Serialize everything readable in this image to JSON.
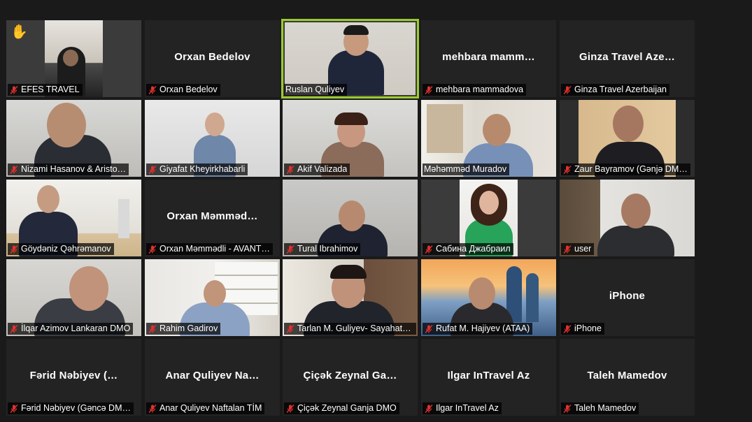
{
  "meeting": {
    "tiles": [
      {
        "label": "EFES TRAVEL",
        "big": "",
        "video": true,
        "hand": true,
        "muted": true
      },
      {
        "label": "Orxan Bedelov",
        "big": "Orxan Bedelov",
        "video": false,
        "muted": true
      },
      {
        "label": "Ruslan Quliyev",
        "big": "",
        "video": true,
        "active": true,
        "muted": false
      },
      {
        "label": "mehbara mammadova",
        "big": "mehbara  mamm…",
        "video": false,
        "muted": true
      },
      {
        "label": "Ginza Travel Azerbaijan",
        "big": "Ginza  Travel  Aze…",
        "video": false,
        "muted": true
      },
      {
        "label": "Nizami Hasanov  &  Aristo…",
        "big": "",
        "video": true,
        "muted": true
      },
      {
        "label": "Giyafat Kheyirkhabarli",
        "big": "",
        "video": true,
        "muted": true
      },
      {
        "label": "Akif Valizada",
        "big": "",
        "video": true,
        "muted": true
      },
      {
        "label": "Məhəmməd Muradov",
        "big": "",
        "video": true,
        "muted": false
      },
      {
        "label": "Zaur Bayramov (Gənjə DM…",
        "big": "",
        "video": true,
        "muted": true
      },
      {
        "label": "Göydəniz Qəhrəmanov",
        "big": "",
        "video": true,
        "muted": true
      },
      {
        "label": "Orxan Məmmədli - AVANT…",
        "big": "Orxan  Məmməd…",
        "video": false,
        "muted": true
      },
      {
        "label": "Tural Ibrahimov",
        "big": "",
        "video": true,
        "muted": true
      },
      {
        "label": "Сабина Джабраил",
        "big": "",
        "video": true,
        "muted": true
      },
      {
        "label": "user",
        "big": "",
        "video": true,
        "muted": true
      },
      {
        "label": "İlqar Azimov Lankaran DMO",
        "big": "",
        "video": true,
        "muted": true
      },
      {
        "label": "Rahim Gadirov",
        "big": "",
        "video": true,
        "muted": true
      },
      {
        "label": "Tarlan M. Guliyev- Sayahat …",
        "big": "",
        "video": true,
        "muted": true
      },
      {
        "label": "Rufat M. Hajiyev (ATAA)",
        "big": "",
        "video": true,
        "muted": true
      },
      {
        "label": "iPhone",
        "big": "iPhone",
        "video": false,
        "muted": true
      },
      {
        "label": "Fərid Nəbiyev (Gəncə DM…",
        "big": "Fərid  Nəbiyev  (…",
        "video": false,
        "muted": true
      },
      {
        "label": "Anar Quliyev Naftalan TİM",
        "big": "Anar  Quliyev  Na…",
        "video": false,
        "muted": true
      },
      {
        "label": "Çiçək Zeynal Ganja DMO",
        "big": "Çiçək  Zeynal  Ga…",
        "video": false,
        "muted": true
      },
      {
        "label": "Ilgar InTravel Az",
        "big": "Ilgar  InTravel  Az",
        "video": false,
        "muted": true
      },
      {
        "label": "Taleh Mamedov",
        "big": "Taleh  Mamedov",
        "video": false,
        "muted": true
      }
    ]
  },
  "colors": {
    "background": "#1a1a1a",
    "tile": "#232323",
    "active_border": "#9ccc2e",
    "muted_icon": "#e0312f"
  },
  "icons": {
    "muted": "mic-muted-icon",
    "hand": "raised-hand-icon"
  }
}
